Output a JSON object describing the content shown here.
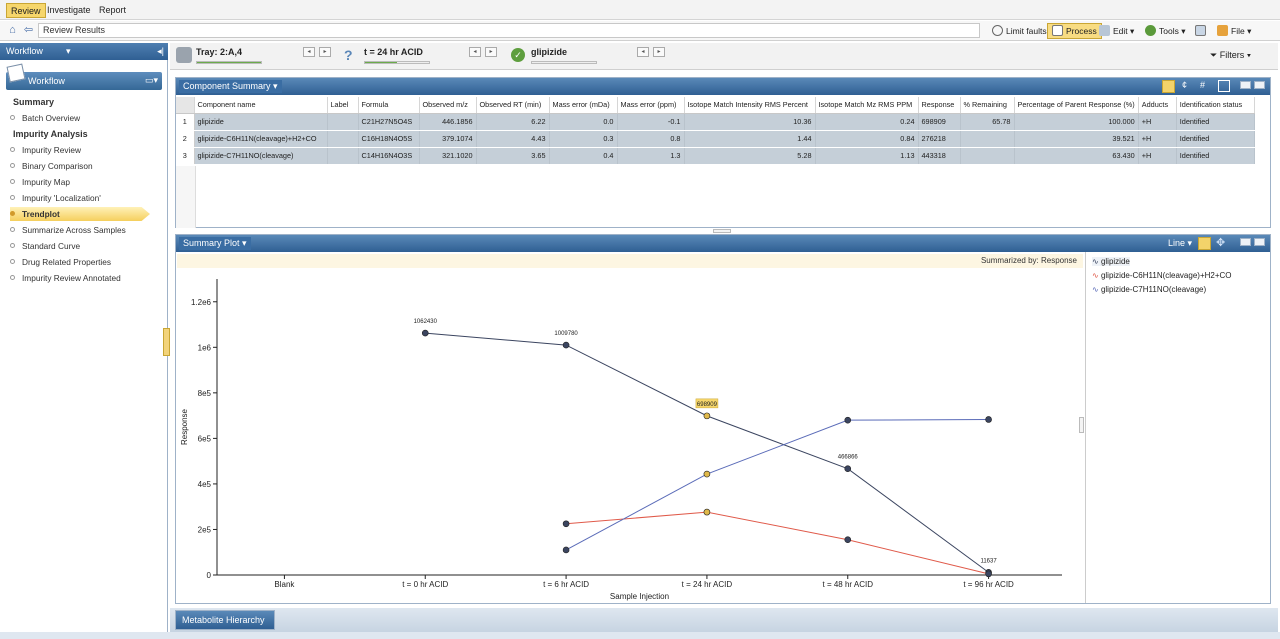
{
  "menu": {
    "tabs": [
      "Review",
      "Investigate",
      "Report"
    ]
  },
  "toolbar": {
    "address": "Review Results",
    "limit_faults": "Limit faults",
    "process": "Process",
    "edit": "Edit",
    "tools": "Tools",
    "file": "File"
  },
  "workflow": {
    "header": "Workflow",
    "title": "Workflow",
    "summary_heading": "Summary",
    "summary_items": [
      "Batch Overview"
    ],
    "impurity_heading": "Impurity Analysis",
    "items": [
      "Impurity Review",
      "Binary Comparison",
      "Impurity Map",
      "Impurity 'Localization'",
      "Trendplot",
      "Summarize Across Samples",
      "Standard Curve",
      "Drug Related Properties",
      "Impurity Review Annotated"
    ],
    "active_item": "Trendplot"
  },
  "status": {
    "tray": "Tray: 2:A,4",
    "sample": "t = 24 hr ACID",
    "component": "glipizide",
    "filters": "Filters",
    "tray_progress": 1.0,
    "sample_progress": 0.5,
    "component_progress": 0.0
  },
  "component_summary": {
    "title": "Component Summary",
    "columns": [
      "Component name",
      "Label",
      "Formula",
      "Observed m/z",
      "Observed RT (min)",
      "Mass error (mDa)",
      "Mass error (ppm)",
      "Isotope Match Intensity RMS Percent",
      "Isotope Match Mz RMS PPM",
      "Response",
      "% Remaining",
      "Percentage of Parent Response (%)",
      "Adducts",
      "Identification status"
    ],
    "rows": [
      [
        "1",
        "glipizide",
        "",
        "C21H27N5O4S",
        "446.1856",
        "6.22",
        "0.0",
        "-0.1",
        "10.36",
        "0.24",
        "698909",
        "65.78",
        "100.000",
        "+H",
        "Identified"
      ],
      [
        "2",
        "glipizide-C6H11N(cleavage)+H2+CO",
        "",
        "C16H18N4O5S",
        "379.1074",
        "4.43",
        "0.3",
        "0.8",
        "1.44",
        "0.84",
        "276218",
        "",
        "39.521",
        "+H",
        "Identified"
      ],
      [
        "3",
        "glipizide-C7H11NO(cleavage)",
        "",
        "C14H16N4O3S",
        "321.1020",
        "3.65",
        "0.4",
        "1.3",
        "5.28",
        "1.13",
        "443318",
        "",
        "63.430",
        "+H",
        "Identified"
      ]
    ]
  },
  "summary_plot": {
    "title": "Summary Plot",
    "mode": "Line",
    "summarized_by": "Summarized by: Response"
  },
  "chart_data": {
    "type": "line",
    "xlabel": "Sample Injection",
    "ylabel": "Response",
    "categories": [
      "Blank",
      "t = 0 hr ACID",
      "t = 6 hr ACID",
      "t = 24 hr ACID",
      "t = 48 hr ACID",
      "t = 96 hr ACID"
    ],
    "ylim": [
      0,
      1300000
    ],
    "yticks": [
      0,
      200000,
      400000,
      600000,
      800000,
      1000000,
      1200000
    ],
    "ytick_labels": [
      "0",
      "2e5",
      "4e5",
      "6e5",
      "8e5",
      "1e6",
      "1.2e6"
    ],
    "series": [
      {
        "name": "glipizide",
        "color": "#3b4560",
        "values": [
          null,
          1062430,
          1009780,
          698909,
          466866,
          11637
        ],
        "labels": [
          "",
          "1062430",
          "1009780",
          "698909",
          "466866",
          "11637"
        ]
      },
      {
        "name": "glipizide-C6H11N(cleavage)+H2+CO",
        "color": "#e05a4a",
        "values": [
          null,
          null,
          225000,
          276218,
          155000,
          5000
        ],
        "labels": [
          "",
          "",
          "",
          "",
          "",
          ""
        ]
      },
      {
        "name": "glipizide-C7H11NO(cleavage)",
        "color": "#5a6bb8",
        "values": [
          null,
          null,
          110000,
          443318,
          680000,
          683000
        ],
        "labels": [
          "",
          "",
          "",
          "",
          "",
          ""
        ]
      }
    ],
    "highlight_category": "t = 24 hr ACID",
    "grid": false,
    "legend": "right"
  },
  "bottom": {
    "tab": "Metabolite Hierarchy"
  }
}
